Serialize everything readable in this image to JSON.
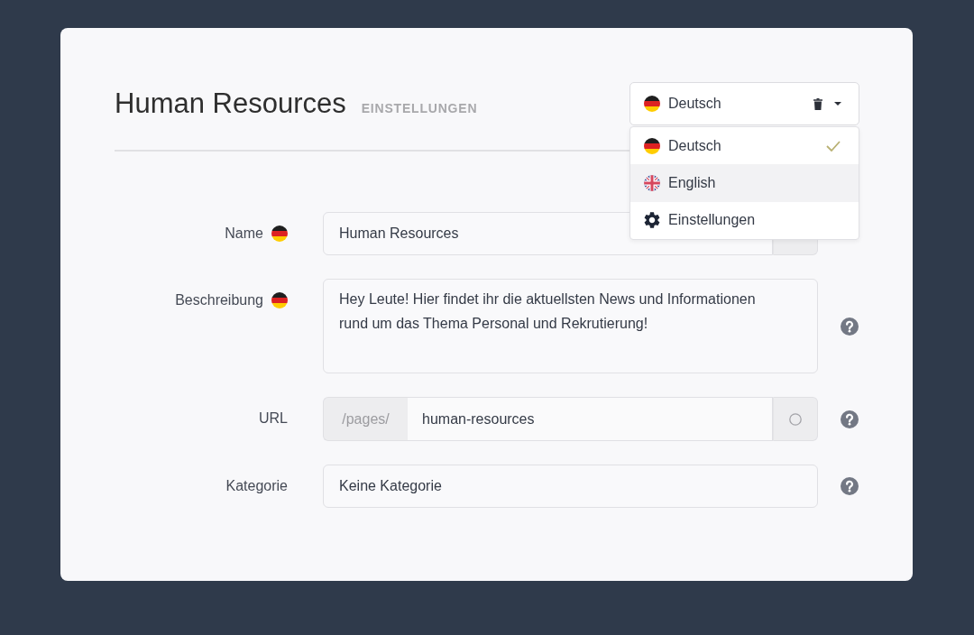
{
  "header": {
    "title": "Human Resources",
    "subtitle": "EINSTELLUNGEN"
  },
  "language_select": {
    "value": "Deutsch",
    "kind": "german",
    "expanded": true,
    "options": [
      {
        "kind": "german",
        "label": "Deutsch",
        "selected": true,
        "highlighted": false
      },
      {
        "kind": "british",
        "label": "English",
        "selected": false,
        "highlighted": true
      },
      {
        "kind": "settings",
        "label": "Einstellungen",
        "selected": false,
        "highlighted": false
      }
    ]
  },
  "form": {
    "fields": [
      {
        "kind": "text",
        "label": "Name",
        "translatable": true,
        "value": "Human Resources",
        "addon": true,
        "help": false
      },
      {
        "kind": "textarea",
        "label": "Beschreibung",
        "translatable": true,
        "value": "Hey Leute! Hier findet ihr die aktuellsten News und Informationen rund um das Thema Personal und Rekrutierung!",
        "addon": false,
        "help": true
      },
      {
        "kind": "url",
        "label": "URL",
        "translatable": false,
        "prefix": "/pages/",
        "value": "human-resources",
        "addon": true,
        "help": true
      },
      {
        "kind": "text",
        "label": "Kategorie",
        "translatable": false,
        "value": "Keine Kategorie",
        "addon": false,
        "help": true
      }
    ]
  }
}
